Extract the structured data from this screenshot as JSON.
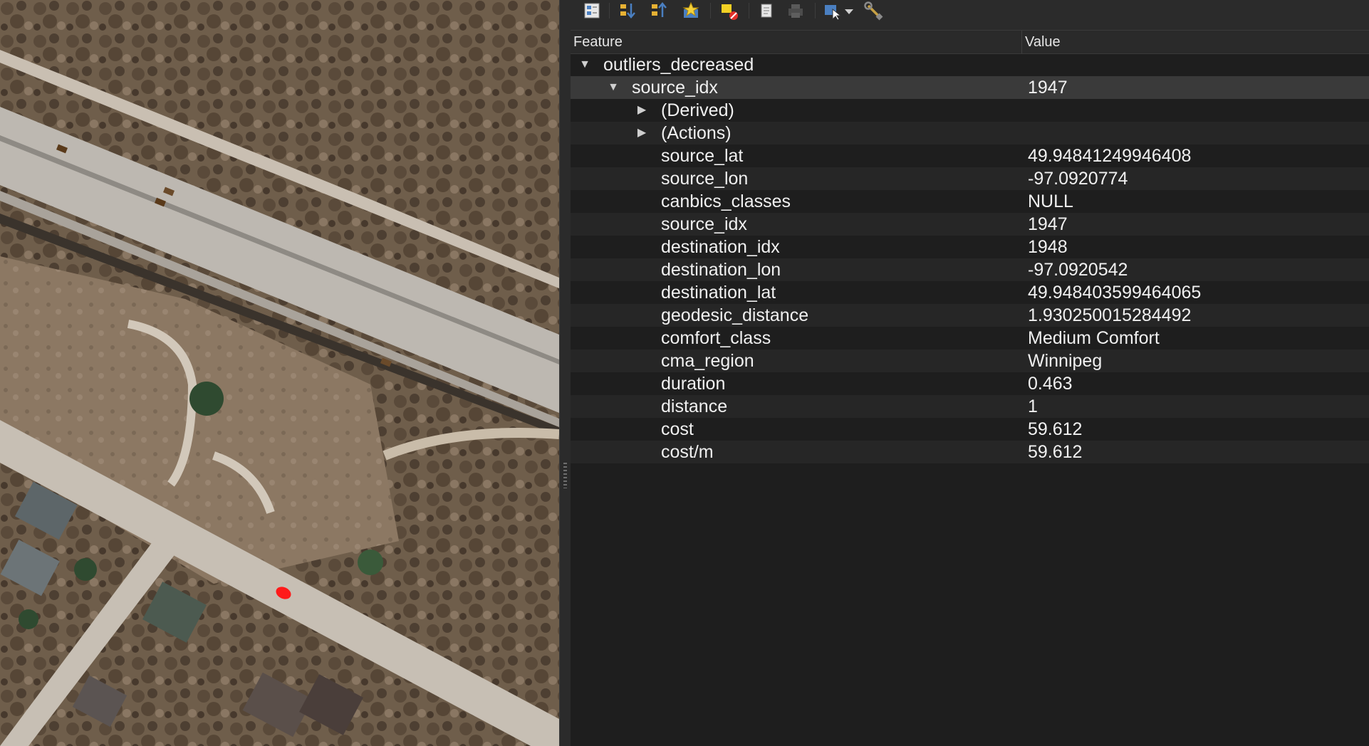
{
  "toolbar": {
    "buttons": [
      {
        "name": "expand-tree-icon"
      },
      {
        "name": "expand-new-features-icon"
      },
      {
        "name": "collapse-tree-icon"
      },
      {
        "name": "highlight-features-icon"
      },
      {
        "name": "clear-results-icon"
      },
      {
        "name": "copy-feature-icon"
      },
      {
        "name": "print-icon"
      },
      {
        "name": "identify-mode-icon"
      },
      {
        "name": "dropdown-icon"
      },
      {
        "name": "settings-wrench-icon"
      }
    ]
  },
  "table": {
    "headers": {
      "feature": "Feature",
      "value": "Value"
    },
    "layer": {
      "label": "outliers_decreased"
    },
    "feature_node": {
      "label": "source_idx",
      "value": "1947"
    },
    "groups": [
      {
        "label": "(Derived)"
      },
      {
        "label": "(Actions)"
      }
    ],
    "attributes": [
      {
        "name": "source_lat",
        "value": "49.94841249946408"
      },
      {
        "name": "source_lon",
        "value": "-97.0920774"
      },
      {
        "name": "canbics_classes",
        "value": "NULL"
      },
      {
        "name": "source_idx",
        "value": "1947"
      },
      {
        "name": "destination_idx",
        "value": "1948"
      },
      {
        "name": "destination_lon",
        "value": "-97.0920542"
      },
      {
        "name": "destination_lat",
        "value": "49.948403599464065"
      },
      {
        "name": "geodesic_distance",
        "value": "1.930250015284492"
      },
      {
        "name": "comfort_class",
        "value": "Medium Comfort"
      },
      {
        "name": "cma_region",
        "value": "Winnipeg"
      },
      {
        "name": "duration",
        "value": "0.463"
      },
      {
        "name": "distance",
        "value": "1"
      },
      {
        "name": "cost",
        "value": "59.612"
      },
      {
        "name": "cost/m",
        "value": "59.612"
      }
    ]
  },
  "colors": {
    "panel_bg": "#1e1e1e",
    "selected_row": "#3a3a3a",
    "marker": "#ff1a1a"
  }
}
